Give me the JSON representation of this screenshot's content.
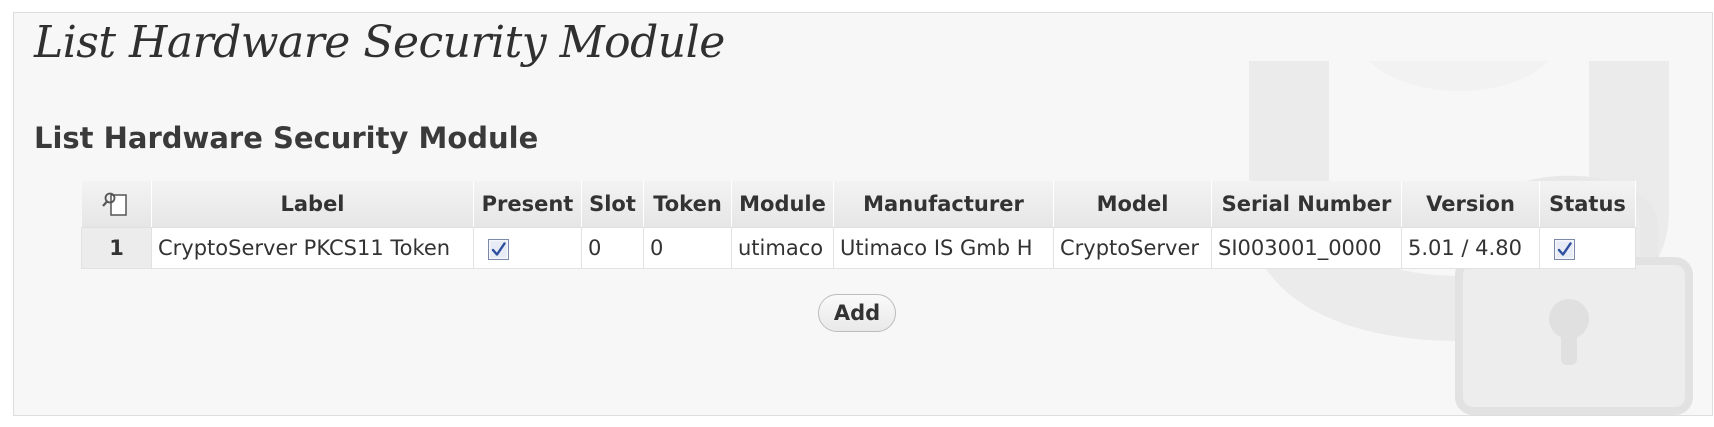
{
  "page": {
    "title": "List Hardware Security Module"
  },
  "section": {
    "title": "List Hardware Security Module"
  },
  "table": {
    "columns": [
      "Label",
      "Present",
      "Slot",
      "Token",
      "Module",
      "Manufacturer",
      "Model",
      "Serial Number",
      "Version",
      "Status"
    ],
    "rows": [
      {
        "index": "1",
        "label": "CryptoServer PKCS11 Token",
        "present": true,
        "slot": "0",
        "token": "0",
        "module": "utimaco",
        "manufacturer": "Utimaco IS Gmb H",
        "model": "CryptoServer",
        "serial_number": "SI003001_0000",
        "version": "5.01 / 4.80",
        "status": true
      }
    ]
  },
  "actions": {
    "add_label": "Add"
  },
  "icons": {
    "header": "column-chooser-icon",
    "watermark": "padlock-icon",
    "checkbox": "checkbox-checked-icon"
  },
  "colors": {
    "panel_background": "#f7f7f7",
    "header_background": "#e9e9e9",
    "checkbox_check": "#2c4f9e"
  }
}
